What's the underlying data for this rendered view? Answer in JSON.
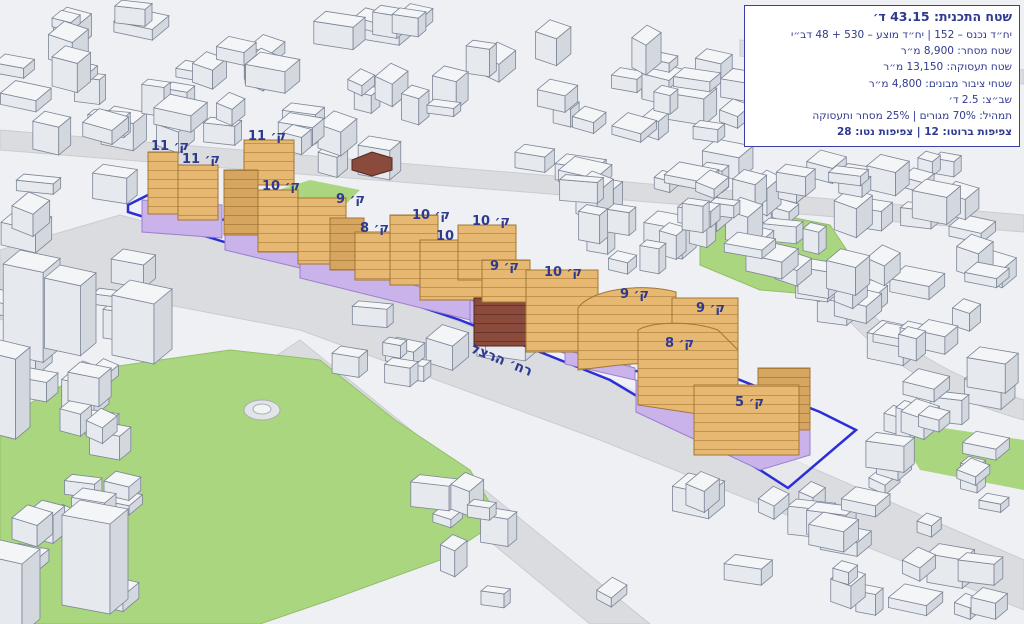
{
  "map": {
    "street_name": "רח׳ הרצל",
    "colors": {
      "plan_boundary": "#2b2fd6",
      "residential": "#e6b872",
      "commercial_base": "#c9b3ea",
      "existing_building": "#8a4a3c",
      "park": "#a9d67f",
      "road": "#d9dbdf",
      "ground": "#eef0f3",
      "context_building": "#e8ebef"
    },
    "buildings": [
      {
        "id": "b1",
        "floors_label": "11 ק׳"
      },
      {
        "id": "b2",
        "floors_label": "11 ק׳"
      },
      {
        "id": "b3",
        "floors_label": "11 ק׳"
      },
      {
        "id": "b4",
        "floors_label": "10 ק׳"
      },
      {
        "id": "b5",
        "floors_label": "9 ק׳"
      },
      {
        "id": "b6",
        "floors_label": "8 ק׳"
      },
      {
        "id": "b7",
        "floors_label": "10 ק׳"
      },
      {
        "id": "b8",
        "floors_label": "10 ק׳"
      },
      {
        "id": "b9",
        "floors_label": "10 ק׳"
      },
      {
        "id": "b10",
        "floors_label": "9 ק׳"
      },
      {
        "id": "b11",
        "floors_label": "10 ק׳"
      },
      {
        "id": "b12",
        "floors_label": "9 ק׳"
      },
      {
        "id": "b13",
        "floors_label": "9 ק׳"
      },
      {
        "id": "b14",
        "floors_label": "8 ק׳"
      },
      {
        "id": "b15",
        "floors_label": "5 ק׳"
      }
    ]
  },
  "info_panel": {
    "title": "שטח התכנית: 43.15 ד׳",
    "rows": [
      "יח״ד נכנס – 152   |   יח״ד מוצע – 530 + 48 דב״י",
      "שטח מסחר: 8,900 מ״ר",
      "שטח תעסוקה: 13,150 מ״ר",
      "שטחי ציבור מבונים: 4,800 מ״ר",
      "שב״צ: 2.5 ד׳",
      "תמהיל: 70% מגורים | 25% מסחר ותעסוקה",
      "צפיפות ברוטו: 12 | צפיפות נטו: 28"
    ]
  }
}
